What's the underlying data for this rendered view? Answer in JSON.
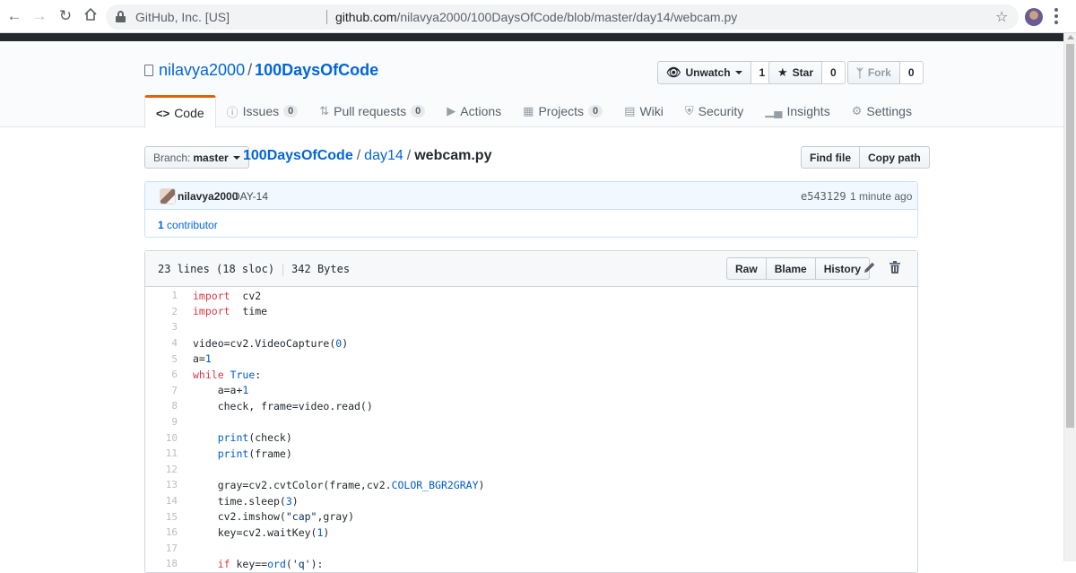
{
  "browser": {
    "org": "GitHub, Inc. [US]",
    "url_domain": "github.com",
    "url_path": "/nilavya2000/100DaysOfCode/blob/master/day14/webcam.py"
  },
  "repo": {
    "owner": "nilavya2000",
    "separator": "/",
    "name": "100DaysOfCode",
    "unwatch_label": "Unwatch",
    "watch_count": "1",
    "star_label": "Star",
    "star_count": "0",
    "fork_label": "Fork",
    "fork_count": "0"
  },
  "tabs": [
    {
      "label": "Code",
      "icon": "code-icon"
    },
    {
      "label": "Issues",
      "count": "0",
      "icon": "issue-icon"
    },
    {
      "label": "Pull requests",
      "count": "0",
      "icon": "pull-request-icon"
    },
    {
      "label": "Actions",
      "icon": "play-icon"
    },
    {
      "label": "Projects",
      "count": "0",
      "icon": "project-icon"
    },
    {
      "label": "Wiki",
      "icon": "book-icon"
    },
    {
      "label": "Security",
      "icon": "shield-icon"
    },
    {
      "label": "Insights",
      "icon": "graph-icon"
    },
    {
      "label": "Settings",
      "icon": "gear-icon"
    }
  ],
  "filenav": {
    "branch_label": "Branch:",
    "branch": "master",
    "crumb_repo": "100DaysOfCode",
    "crumb_dir": "day14",
    "crumb_file": "webcam.py",
    "sep": "/",
    "find_file": "Find file",
    "copy_path": "Copy path"
  },
  "commit": {
    "author": "nilavya2000",
    "message": "DAY-14",
    "sha": "e543129",
    "time": "1 minute ago",
    "contributor_count": "1",
    "contributor_label": "contributor"
  },
  "file": {
    "lines_info": "23 lines (18 sloc)",
    "size": "342 Bytes",
    "raw": "Raw",
    "blame": "Blame",
    "history": "History"
  },
  "code_lines": [
    [
      [
        "kw",
        "import"
      ],
      [
        "",
        "  cv2"
      ]
    ],
    [
      [
        "kw",
        "import"
      ],
      [
        "",
        "  time"
      ]
    ],
    [],
    [
      [
        "",
        "video=cv2.VideoCapture("
      ],
      [
        "nm",
        "0"
      ],
      [
        "",
        ")"
      ]
    ],
    [
      [
        "",
        "a="
      ],
      [
        "nm",
        "1"
      ]
    ],
    [
      [
        "kw",
        "while"
      ],
      [
        "",
        " "
      ],
      [
        "nm",
        "True"
      ],
      [
        "",
        ":"
      ]
    ],
    [
      [
        "",
        "    a=a+"
      ],
      [
        "nm",
        "1"
      ]
    ],
    [
      [
        "",
        "    check, frame=video.read()"
      ]
    ],
    [],
    [
      [
        "fn",
        "    print"
      ],
      [
        "",
        "(check)"
      ]
    ],
    [
      [
        "fn",
        "    print"
      ],
      [
        "",
        "(frame)"
      ]
    ],
    [],
    [
      [
        "",
        "    gray=cv2.cvtColor(frame,cv2."
      ],
      [
        "nm",
        "COLOR_BGR2GRAY"
      ],
      [
        "",
        ")"
      ]
    ],
    [
      [
        "",
        "    time.sleep("
      ],
      [
        "nm",
        "3"
      ],
      [
        "",
        ")"
      ]
    ],
    [
      [
        "",
        "    cv2.imshow("
      ],
      [
        "st",
        "\"cap\""
      ],
      [
        "",
        ",gray)"
      ]
    ],
    [
      [
        "",
        "    key=cv2.waitKey("
      ],
      [
        "nm",
        "1"
      ],
      [
        "",
        ")"
      ]
    ],
    [],
    [
      [
        "",
        "    "
      ],
      [
        "kw",
        "if"
      ],
      [
        "",
        " key=="
      ],
      [
        "fn",
        "ord"
      ],
      [
        "",
        "("
      ],
      [
        "st",
        "'q'"
      ],
      [
        "",
        "):"
      ]
    ]
  ]
}
